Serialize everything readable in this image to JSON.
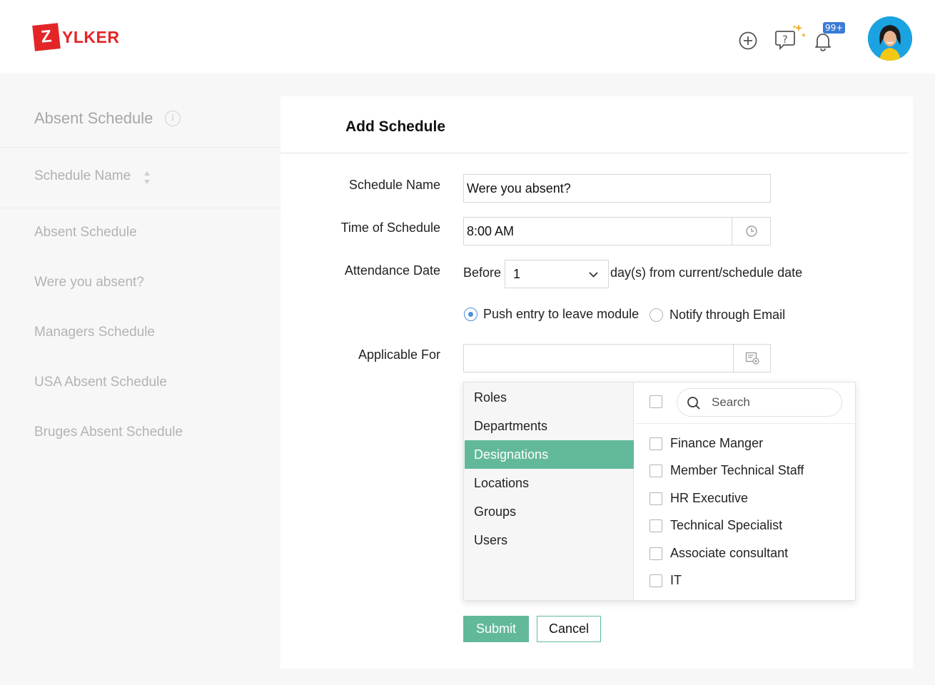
{
  "header": {
    "logo_letter": "Z",
    "logo_rest": "YLKER",
    "notification_count": "99+",
    "icons": [
      "add-circle-icon",
      "help-sparkle-icon",
      "bell-icon",
      "user-avatar"
    ],
    "brand_color": "#e42527"
  },
  "left_panel": {
    "title": "Absent Schedule",
    "column_header": "Schedule Name",
    "items": [
      "Absent Schedule",
      "Were you absent?",
      "Managers Schedule",
      "USA Absent Schedule",
      "Bruges Absent Schedule"
    ]
  },
  "modal": {
    "title": "Add Schedule",
    "fields": {
      "schedule_name_label": "Schedule Name",
      "schedule_name_value": "Were you absent?",
      "time_label": "Time of Schedule",
      "time_value": "8:00 AM",
      "attendance_label": "Attendance Date",
      "before_text": "Before",
      "days_value": "1",
      "days_suffix": "day(s) from current/schedule date",
      "applicable_label": "Applicable For",
      "applicable_value": ""
    },
    "radio_options": [
      {
        "label": "Push entry to leave module",
        "selected": true
      },
      {
        "label": "Notify through Email",
        "selected": false
      }
    ],
    "dropdown": {
      "categories": [
        "Roles",
        "Departments",
        "Designations",
        "Locations",
        "Groups",
        "Users"
      ],
      "active_category": "Designations",
      "search_placeholder": "Search",
      "options": [
        "Finance Manger",
        "Member Technical Staff",
        "HR Executive",
        "Technical Specialist",
        "Associate consultant",
        "IT"
      ]
    },
    "buttons": {
      "submit": "Submit",
      "cancel": "Cancel"
    },
    "accent_color": "#62b99a"
  }
}
